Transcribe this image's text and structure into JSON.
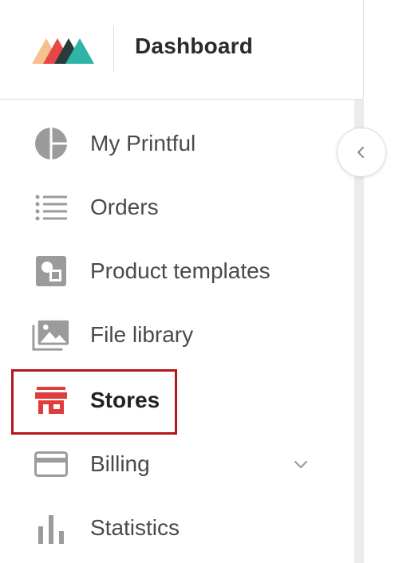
{
  "header": {
    "title": "Dashboard",
    "logo": "printful-logo"
  },
  "sidebar": {
    "items": [
      {
        "label": "My Printful",
        "icon": "pie-chart-icon"
      },
      {
        "label": "Orders",
        "icon": "list-icon"
      },
      {
        "label": "Product templates",
        "icon": "template-icon"
      },
      {
        "label": "File library",
        "icon": "image-library-icon"
      },
      {
        "label": "Stores",
        "icon": "store-icon",
        "active": true
      },
      {
        "label": "Billing",
        "icon": "credit-card-icon",
        "expandable": true
      },
      {
        "label": "Statistics",
        "icon": "bar-chart-icon"
      }
    ],
    "collapse_button_icon": "chevron-left-icon"
  },
  "colors": {
    "accent": "#e03c3c",
    "highlight_border": "#b3161d",
    "icon_gray": "#9b9b9b",
    "text": "#4a4a4a"
  }
}
